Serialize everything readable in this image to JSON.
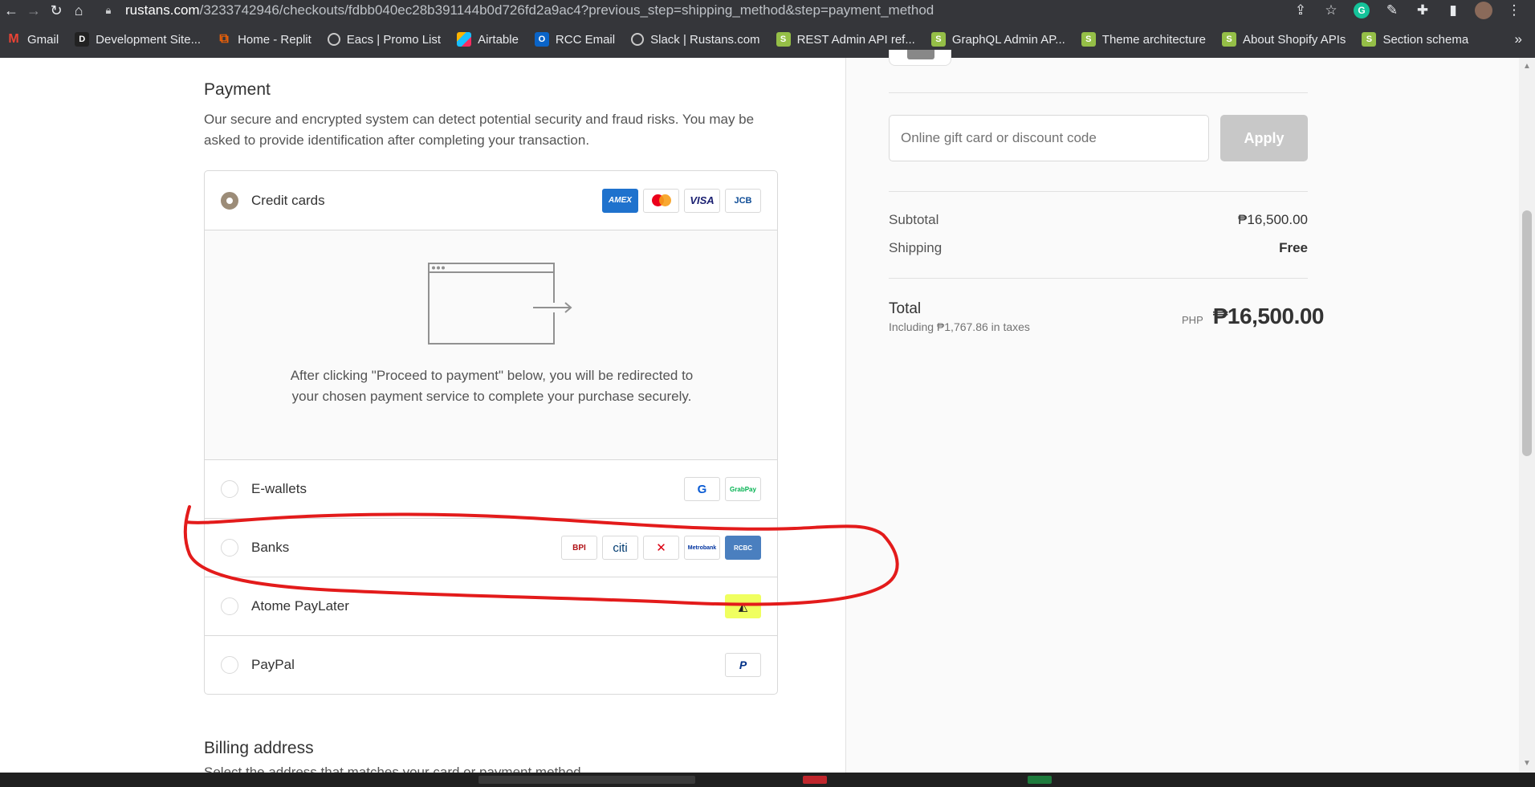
{
  "browser": {
    "url_domain": "rustans.com",
    "url_path": "/3233742946/checkouts/fdbb040ec28b391144b0d726fd2a9ac4?previous_step=shipping_method&step=payment_method",
    "bookmarks": [
      {
        "label": "Gmail",
        "icon": "gmail-icon"
      },
      {
        "label": "Development Site...",
        "icon": "dev-icon"
      },
      {
        "label": "Home - Replit",
        "icon": "replit-icon"
      },
      {
        "label": "Eacs | Promo List",
        "icon": "globe-icon"
      },
      {
        "label": "Airtable",
        "icon": "airtable-icon"
      },
      {
        "label": "RCC Email",
        "icon": "outlook-icon"
      },
      {
        "label": "Slack | Rustans.com",
        "icon": "globe-icon"
      },
      {
        "label": "REST Admin API ref...",
        "icon": "shopify-icon"
      },
      {
        "label": "GraphQL Admin AP...",
        "icon": "shopify-icon"
      },
      {
        "label": "Theme architecture",
        "icon": "shopify-icon"
      },
      {
        "label": "About Shopify APIs",
        "icon": "shopify-icon"
      },
      {
        "label": "Section schema",
        "icon": "shopify-icon"
      }
    ],
    "more_label": "»"
  },
  "payment": {
    "title": "Payment",
    "description": "Our secure and encrypted system can detect potential security and fraud risks. You may be asked to provide identification after completing your transaction.",
    "methods": [
      {
        "label": "Credit cards",
        "selected": true,
        "logos": [
          "AMEX",
          "MC",
          "VISA",
          "JCB"
        ]
      },
      {
        "label": "E-wallets",
        "selected": false,
        "logos": [
          "G",
          "GrabPay"
        ]
      },
      {
        "label": "Banks",
        "selected": false,
        "logos": [
          "BPI",
          "citi",
          "HSBC",
          "Metrobank",
          "RCBC"
        ]
      },
      {
        "label": "Atome PayLater",
        "selected": false,
        "logos": [
          "A"
        ]
      },
      {
        "label": "PayPal",
        "selected": false,
        "logos": [
          "P"
        ]
      }
    ],
    "redirect_text": "After clicking \"Proceed to payment\" below, you will be redirected to your chosen payment service to complete your purchase securely."
  },
  "billing": {
    "title": "Billing address",
    "description": "Select the address that matches your card or payment method."
  },
  "summary": {
    "discount_placeholder": "Online gift card or discount code",
    "apply_label": "Apply",
    "subtotal_label": "Subtotal",
    "subtotal_value": "₱16,500.00",
    "shipping_label": "Shipping",
    "shipping_value": "Free",
    "total_label": "Total",
    "total_tax_note": "Including ₱1,767.86 in taxes",
    "total_currency": "PHP",
    "total_value": "₱16,500.00"
  },
  "colors": {
    "annotation": "#e31b1b",
    "radio_selected": "#9c8c78",
    "chrome_bg": "#35363a"
  }
}
